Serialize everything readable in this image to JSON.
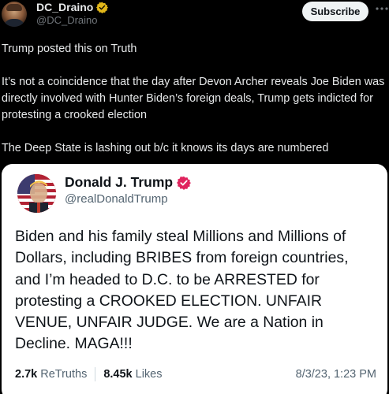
{
  "author": {
    "display_name": "DC_Draino",
    "handle": "@DC_Draino",
    "verified": true,
    "subscribe_label": "Subscribe"
  },
  "post": {
    "paragraph1": "Trump posted this on Truth",
    "paragraph2_lines": [
      "It’s not a coincidence that the day after Devon Archer reveals Joe Biden was",
      "directly involved with Hunter Biden’s foreign deals, Trump gets indicted for",
      "protesting a crooked election"
    ],
    "paragraph3": "The Deep State is lashing out b/c it knows its days are numbered"
  },
  "quoted_card": {
    "display_name": "Donald J. Trump",
    "handle": "@realDonaldTrump",
    "verified": true,
    "body_lines": [
      "Biden and his family steal Millions and Millions of",
      "Dollars, including BRIBES from foreign countries,",
      "and I’m headed to D.C. to be ARRESTED for",
      "protesting a CROOKED ELECTION. UNFAIR",
      "VENUE, UNFAIR JUDGE. We are a Nation in",
      "Decline. MAGA!!!"
    ],
    "retruths_count": "2.7k",
    "retruths_label": "ReTruths",
    "likes_count": "8.45k",
    "likes_label": "Likes",
    "timestamp": "8/3/23, 1:23 PM"
  },
  "colors": {
    "background": "#000000",
    "text_primary": "#e7e9ea",
    "text_secondary": "#71767b",
    "verified_gold": "#e2b719",
    "truth_verified_red": "#e0245e"
  }
}
